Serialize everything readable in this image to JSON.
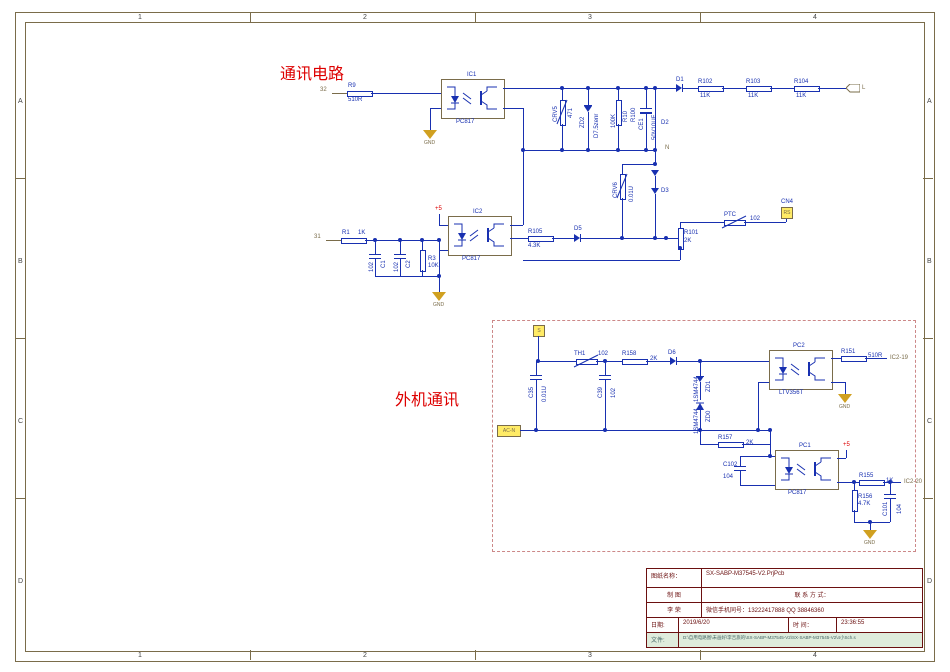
{
  "rulers": {
    "cols": [
      "1",
      "2",
      "3",
      "4"
    ],
    "rows": [
      "A",
      "B",
      "C",
      "D"
    ]
  },
  "sections": {
    "comm": {
      "title": "通讯电路"
    },
    "outdoor": {
      "title": "外机通讯"
    }
  },
  "labels": {
    "gnd": "GND",
    "plus5": "+5"
  },
  "net": {
    "p32": "32",
    "p31": "31",
    "L": "L",
    "N": "N",
    "RS": "RS",
    "S": "S",
    "ACN": "AC-N",
    "ic2_19": "IC2-19",
    "ic2_20": "IC2-20",
    "CN4": "CN4"
  },
  "components": {
    "IC1": {
      "ref": "IC1",
      "val": "PC817"
    },
    "IC2": {
      "ref": "IC2",
      "val": "PC817"
    },
    "PC1": {
      "ref": "PC1",
      "val": "PC817"
    },
    "PC2": {
      "ref": "PC2",
      "val": "LTV356T"
    },
    "R9": {
      "ref": "R9",
      "val": "510R"
    },
    "R1": {
      "ref": "R1",
      "val": "1K"
    },
    "R3": {
      "ref": "R3",
      "val": "10K"
    },
    "R10": {
      "ref": "R10",
      "val": "100K"
    },
    "R100": {
      "ref": "R100",
      "val": ""
    },
    "R101": {
      "ref": "R101",
      "val": "2K"
    },
    "R102": {
      "ref": "R102",
      "val": "11K"
    },
    "R103": {
      "ref": "R103",
      "val": "11K"
    },
    "R104": {
      "ref": "R104",
      "val": "11K"
    },
    "R105": {
      "ref": "R105",
      "val": "4.3K"
    },
    "R151": {
      "ref": "R151",
      "val": "510R"
    },
    "R155": {
      "ref": "R155",
      "val": "1K"
    },
    "R156": {
      "ref": "R156",
      "val": "4.7K"
    },
    "R157": {
      "ref": "R157",
      "val": "2K"
    },
    "R158": {
      "ref": "R158",
      "val": "2K"
    },
    "C1": {
      "ref": "C1",
      "val": "102"
    },
    "C2": {
      "ref": "C2",
      "val": "102"
    },
    "C35": {
      "ref": "C35",
      "val": "0.01U"
    },
    "C39": {
      "ref": "C39",
      "val": "102"
    },
    "C101": {
      "ref": "C101",
      "val": "104"
    },
    "C102": {
      "ref": "C102",
      "val": "104"
    },
    "CE1": {
      "ref": "CE1",
      "val": "50V10UF"
    },
    "CRV5": {
      "ref": "CRV5",
      "val": "471"
    },
    "CRV6": {
      "ref": "CRV6",
      "val": "0.01U"
    },
    "D1": {
      "ref": "D1",
      "val": ""
    },
    "D2": {
      "ref": "D2",
      "val": ""
    },
    "D3": {
      "ref": "D3",
      "val": ""
    },
    "D5": {
      "ref": "D5",
      "val": ""
    },
    "D6": {
      "ref": "D6",
      "val": ""
    },
    "ZD0": {
      "ref": "ZD0",
      "val": "1SM4744"
    },
    "ZD1": {
      "ref": "ZD1",
      "val": "1SM4744"
    },
    "ZD2": {
      "ref": "ZD2",
      "val": "D7.5zenr"
    },
    "TH1": {
      "ref": "TH1",
      "val": "102"
    },
    "PTC": {
      "ref": "PTC",
      "val": "102"
    }
  },
  "titleblock": {
    "row1": {
      "label": "图纸名称：",
      "value": "SX-SABP-M37545-V2.PrjPcb"
    },
    "row2": {
      "c1": "制 图",
      "c2": "联 系 方 式："
    },
    "row3": {
      "c1": "李 荣",
      "c2": "微信手机同号：13222417888 QQ 38846360"
    },
    "row4": {
      "c1": "日期:",
      "c2": "2019/6/20",
      "c3": "时 间：",
      "c4": "23:36:55"
    },
    "row5": {
      "c1": "文件:",
      "c2": "D:\\自用电路图\\未画好\\李吉旅的\\SX-SABP-M37545-V2\\SX-SABP-M37545-V2\\4小Sch.s"
    }
  }
}
